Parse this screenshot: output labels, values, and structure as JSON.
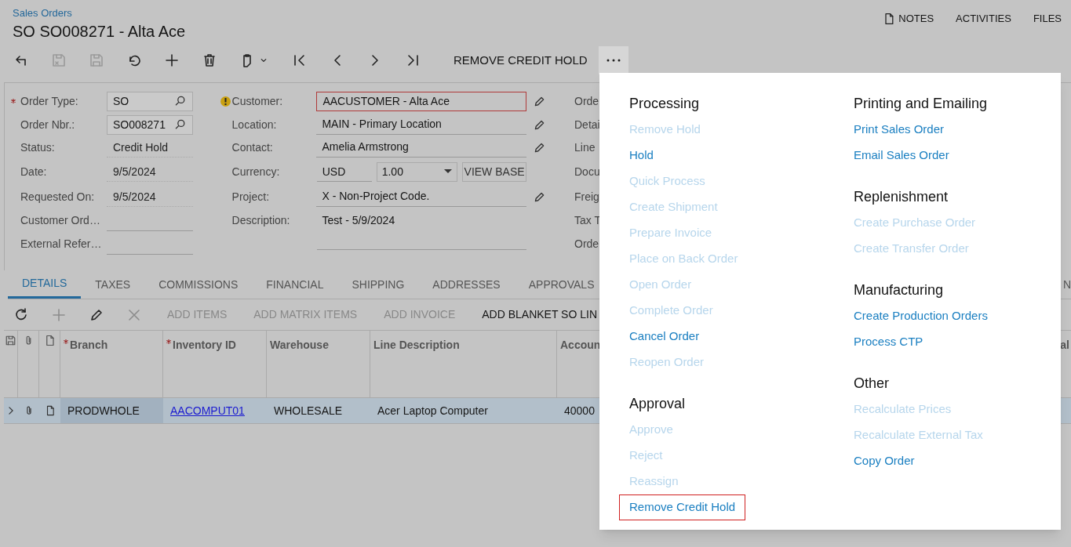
{
  "breadcrumb": "Sales Orders",
  "title": "SO SO008271 - Alta Ace",
  "header_links": [
    {
      "label": "NOTES",
      "kind": "notes"
    },
    {
      "label": "ACTIVITIES",
      "kind": "plain"
    },
    {
      "label": "FILES",
      "kind": "plain"
    }
  ],
  "toolbar": {
    "icons": [
      {
        "kind": "back",
        "disabled": false
      },
      {
        "kind": "save-close",
        "disabled": true
      },
      {
        "kind": "save",
        "disabled": true
      },
      {
        "kind": "undo",
        "disabled": false
      },
      {
        "kind": "add",
        "disabled": false
      },
      {
        "kind": "delete",
        "disabled": false
      },
      {
        "kind": "clipboard",
        "disabled": false
      },
      {
        "kind": "first",
        "disabled": false
      },
      {
        "kind": "prev",
        "disabled": false
      },
      {
        "kind": "next",
        "disabled": false
      },
      {
        "kind": "last",
        "disabled": false
      }
    ],
    "action": "REMOVE CREDIT HOLD",
    "more_open": true
  },
  "form": {
    "column_1": [
      {
        "label": "Order Type:",
        "value": "SO",
        "required": true,
        "kind": "lookup"
      },
      {
        "label": "Order Nbr.:",
        "value": "SO008271",
        "required": false,
        "kind": "lookup"
      },
      {
        "label": "Status:",
        "value": "Credit Hold",
        "required": false,
        "kind": "readonly"
      },
      {
        "label": "Date:",
        "value": "9/5/2024",
        "required": false,
        "kind": "readonly"
      },
      {
        "label": "Requested On:",
        "value": "9/5/2024",
        "required": false,
        "kind": "readonly"
      },
      {
        "label": "Customer Ord…",
        "required": false,
        "kind": "text"
      },
      {
        "label": "External Refer…",
        "required": false,
        "kind": "text"
      }
    ],
    "column_2": [
      {
        "label": "Customer:",
        "value": "AACUSTOMER - Alta Ace",
        "kind": "text",
        "warning": true,
        "error": true,
        "editable": true
      },
      {
        "label": "Location:",
        "value": "MAIN - Primary Location",
        "kind": "text",
        "warning": false,
        "error": false,
        "editable": true
      },
      {
        "label": "Contact:",
        "value": "Amelia Armstrong",
        "kind": "text",
        "warning": false,
        "error": false,
        "editable": true
      },
      {
        "label": "Currency:",
        "value": "USD",
        "rate": "1.00",
        "button": "VIEW BASE",
        "kind": "currency",
        "warning": false,
        "error": false,
        "editable": false
      },
      {
        "label": "Project:",
        "value": "X - Non-Project Code.",
        "kind": "text",
        "warning": false,
        "error": false,
        "editable": true
      },
      {
        "label": "Description:",
        "value": "Test - 5/9/2024",
        "kind": "textarea",
        "warning": false,
        "error": false,
        "editable": false
      }
    ],
    "column_3": [
      "Orde",
      "Detai",
      "Line",
      "Docu",
      "Freig",
      "Tax T",
      "Orde"
    ]
  },
  "tabs": [
    {
      "label": "DETAILS",
      "selected": true
    },
    {
      "label": "TAXES",
      "selected": false
    },
    {
      "label": "COMMISSIONS",
      "selected": false
    },
    {
      "label": "FINANCIAL",
      "selected": false
    },
    {
      "label": "SHIPPING",
      "selected": false
    },
    {
      "label": "ADDRESSES",
      "selected": false
    },
    {
      "label": "APPROVALS",
      "selected": false
    }
  ],
  "tab_fragment": "N",
  "grid_toolbar": {
    "icons": [
      {
        "kind": "refresh",
        "disabled": false
      },
      {
        "kind": "add",
        "disabled": true
      },
      {
        "kind": "edit",
        "disabled": false
      },
      {
        "kind": "delete",
        "disabled": true
      }
    ],
    "buttons": [
      {
        "label": "ADD ITEMS",
        "disabled": true
      },
      {
        "label": "ADD MATRIX ITEMS",
        "disabled": true
      },
      {
        "label": "ADD INVOICE",
        "disabled": true
      },
      {
        "label": "ADD BLANKET SO LIN",
        "disabled": false
      }
    ]
  },
  "grid": {
    "columns": [
      {
        "label": "Branch",
        "required": true
      },
      {
        "label": "Inventory ID",
        "required": true
      },
      {
        "label": "Warehouse",
        "required": false
      },
      {
        "label": "Line Description",
        "required": false
      },
      {
        "label": "Accoun",
        "required": false
      }
    ],
    "header_fragment": "al",
    "rows": [
      {
        "selected": true,
        "cells": [
          "PRODWHOLE",
          "AACOMPUT01",
          "WHOLESALE",
          "Acer Laptop Computer",
          "40000"
        ]
      }
    ]
  },
  "menu": {
    "columns": [
      [
        {
          "heading": "Processing",
          "items": [
            {
              "label": "Remove Hold",
              "enabled": false,
              "highlighted": false
            },
            {
              "label": "Hold",
              "enabled": true,
              "highlighted": false
            },
            {
              "label": "Quick Process",
              "enabled": false,
              "highlighted": false
            },
            {
              "label": "Create Shipment",
              "enabled": false,
              "highlighted": false
            },
            {
              "label": "Prepare Invoice",
              "enabled": false,
              "highlighted": false
            },
            {
              "label": "Place on Back Order",
              "enabled": false,
              "highlighted": false
            },
            {
              "label": "Open Order",
              "enabled": false,
              "highlighted": false
            },
            {
              "label": "Complete Order",
              "enabled": false,
              "highlighted": false
            },
            {
              "label": "Cancel Order",
              "enabled": true,
              "highlighted": false
            },
            {
              "label": "Reopen Order",
              "enabled": false,
              "highlighted": false
            }
          ]
        },
        {
          "heading": "Approval",
          "items": [
            {
              "label": "Approve",
              "enabled": false,
              "highlighted": false
            },
            {
              "label": "Reject",
              "enabled": false,
              "highlighted": false
            },
            {
              "label": "Reassign",
              "enabled": false,
              "highlighted": false
            },
            {
              "label": "Remove Credit Hold",
              "enabled": true,
              "highlighted": true
            }
          ]
        }
      ],
      [
        {
          "heading": "Printing and Emailing",
          "items": [
            {
              "label": "Print Sales Order",
              "enabled": true,
              "highlighted": false
            },
            {
              "label": "Email Sales Order",
              "enabled": true,
              "highlighted": false
            }
          ]
        },
        {
          "heading": "Replenishment",
          "items": [
            {
              "label": "Create Purchase Order",
              "enabled": false,
              "highlighted": false
            },
            {
              "label": "Create Transfer Order",
              "enabled": false,
              "highlighted": false
            }
          ]
        },
        {
          "heading": "Manufacturing",
          "items": [
            {
              "label": "Create Production Orders",
              "enabled": true,
              "highlighted": false
            },
            {
              "label": "Process CTP",
              "enabled": true,
              "highlighted": false
            }
          ]
        },
        {
          "heading": "Other",
          "items": [
            {
              "label": "Recalculate Prices",
              "enabled": false,
              "highlighted": false
            },
            {
              "label": "Recalculate External Tax",
              "enabled": false,
              "highlighted": false
            },
            {
              "label": "Copy Order",
              "enabled": true,
              "highlighted": false
            }
          ]
        }
      ]
    ]
  }
}
